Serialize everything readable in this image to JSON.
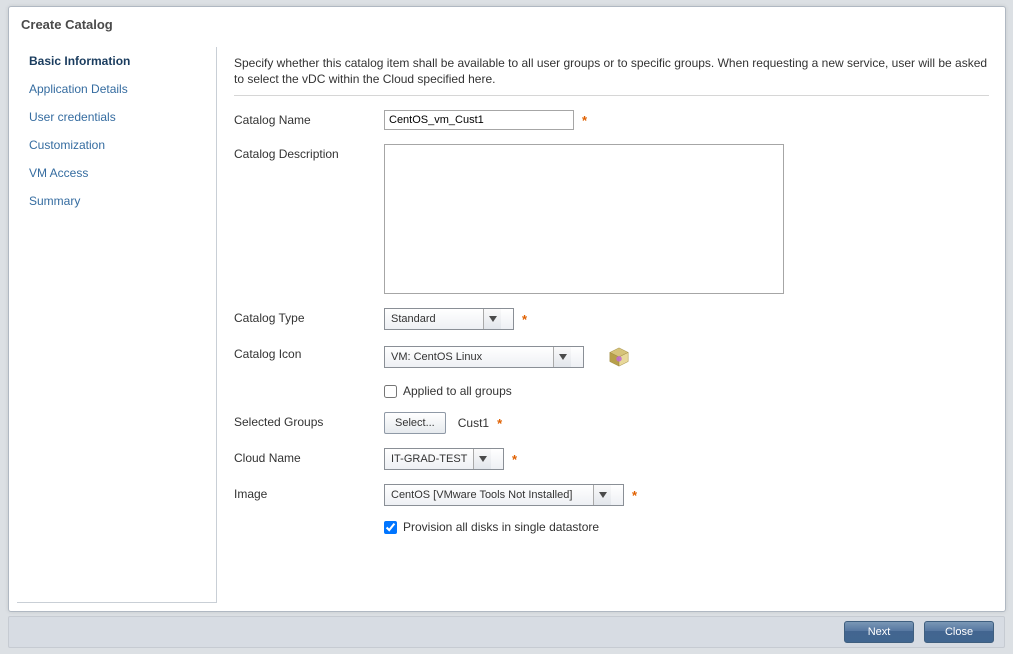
{
  "dialog": {
    "title": "Create Catalog"
  },
  "sidebar": {
    "items": [
      {
        "label": "Basic Information",
        "active": true
      },
      {
        "label": "Application Details"
      },
      {
        "label": "User credentials"
      },
      {
        "label": "Customization"
      },
      {
        "label": "VM Access"
      },
      {
        "label": "Summary"
      }
    ]
  },
  "main": {
    "description": "Specify whether this catalog item shall be available to all user groups or to specific groups.  When requesting a new service, user will be asked to select the vDC within the Cloud specified here.",
    "fields": {
      "catalog_name_label": "Catalog Name",
      "catalog_name_value": "CentOS_vm_Cust1",
      "catalog_desc_label": "Catalog Description",
      "catalog_desc_value": "",
      "catalog_type_label": "Catalog Type",
      "catalog_type_value": "Standard",
      "catalog_icon_label": "Catalog Icon",
      "catalog_icon_value": "VM: CentOS Linux",
      "applied_all_label": "Applied to all groups",
      "applied_all_checked": false,
      "selected_groups_label": "Selected Groups",
      "select_button_label": "Select...",
      "selected_groups_value": "Cust1",
      "cloud_name_label": "Cloud Name",
      "cloud_name_value": "IT-GRAD-TEST",
      "image_label": "Image",
      "image_value": "CentOS [VMware Tools Not Installed]",
      "provision_label": "Provision all disks in single datastore",
      "provision_checked": true
    }
  },
  "footer": {
    "next": "Next",
    "close": "Close"
  },
  "icons": {
    "dropdown": "chevron-down-icon",
    "catalog_image": "server-cube-icon"
  }
}
